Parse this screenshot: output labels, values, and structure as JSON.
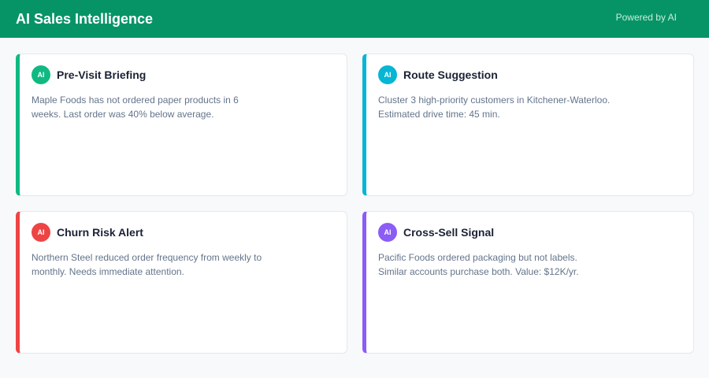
{
  "header": {
    "title": "AI Sales Intelligence",
    "powered_by": "Powered by AI"
  },
  "colors": {
    "header_bg": "#069467",
    "green": "#10b981",
    "cyan": "#06b6d4",
    "red": "#ef4444",
    "purple": "#8b5cf6"
  },
  "cards": [
    {
      "badge": "AI",
      "title": "Pre-Visit Briefing",
      "body": "Maple Foods has not ordered paper products in 6 weeks. Last order was 40% below average.",
      "accent": "#10b981"
    },
    {
      "badge": "AI",
      "title": "Route Suggestion",
      "body": "Cluster 3 high-priority customers in Kitchener-Waterloo. Estimated drive time: 45 min.",
      "accent": "#06b6d4"
    },
    {
      "badge": "AI",
      "title": "Churn Risk Alert",
      "body": "Northern Steel reduced order frequency from weekly to monthly. Needs immediate attention.",
      "accent": "#ef4444"
    },
    {
      "badge": "AI",
      "title": "Cross-Sell Signal",
      "body": "Pacific Foods ordered packaging but not labels. Similar accounts purchase both. Value: $12K/yr.",
      "accent": "#8b5cf6"
    }
  ]
}
